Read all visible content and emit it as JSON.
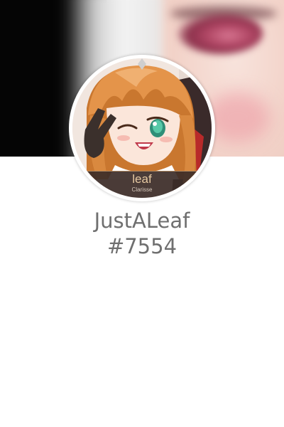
{
  "profile": {
    "username": "JustALeaf",
    "discriminator": "#7554"
  },
  "avatar": {
    "plate_name": "leaf",
    "plate_subtitle": "Clarisse"
  },
  "colors": {
    "text": "#6f6f6f",
    "background": "#ffffff",
    "hair": "#d9893f",
    "eye": "#3aa98d"
  }
}
